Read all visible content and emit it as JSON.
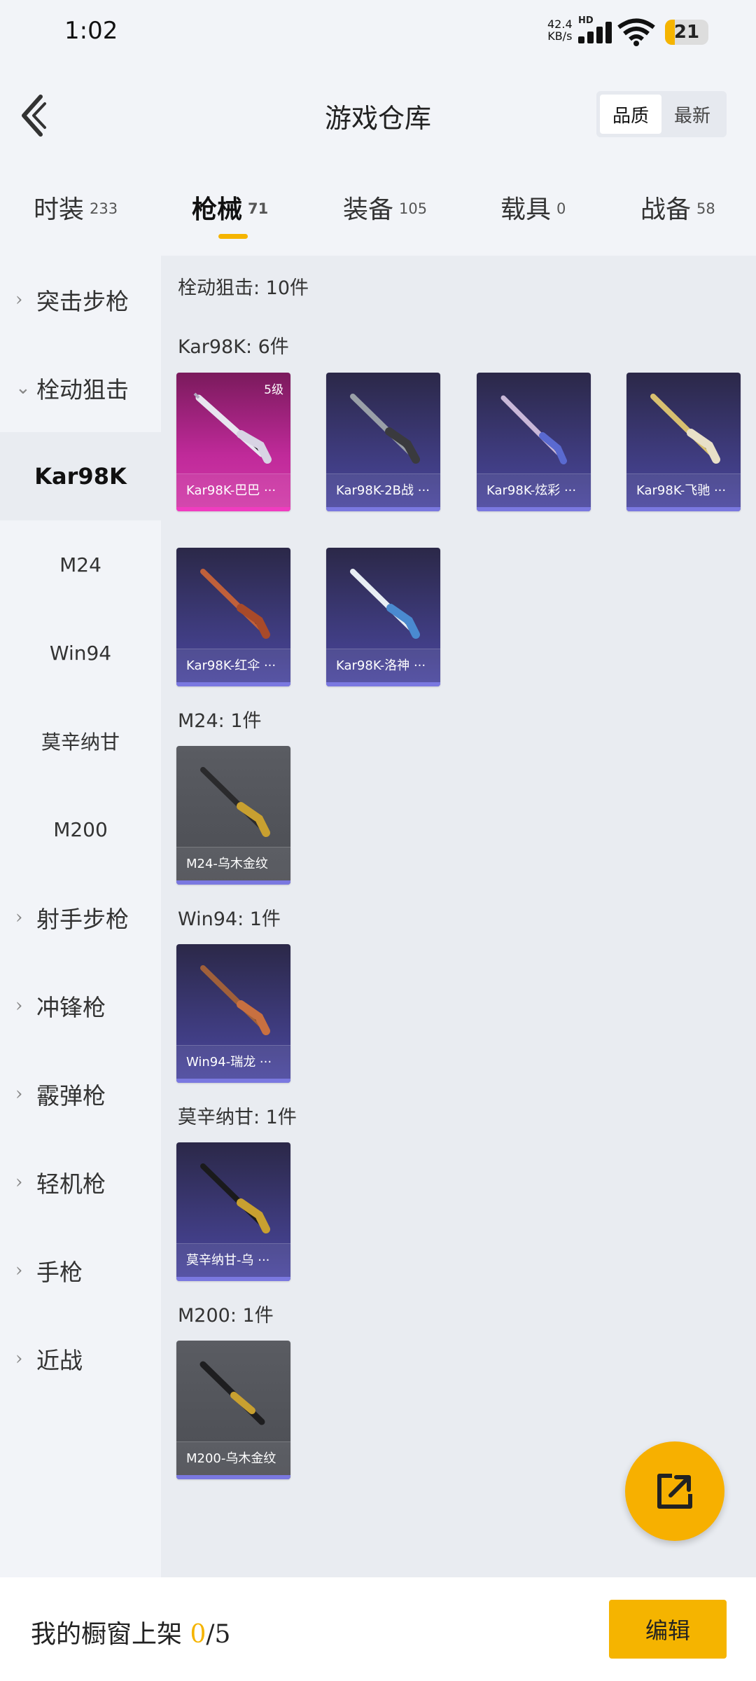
{
  "status_bar": {
    "time": "1:02",
    "net_speed_value": "42.4",
    "net_speed_unit": "KB/s",
    "net_type": "HD",
    "battery": "21"
  },
  "header": {
    "title": "游戏仓库",
    "sort_options": [
      "品质",
      "最新"
    ],
    "sort_selected": "品质"
  },
  "tabs": [
    {
      "label": "时装",
      "count": "233"
    },
    {
      "label": "枪械",
      "count": "71",
      "active": true
    },
    {
      "label": "装备",
      "count": "105"
    },
    {
      "label": "载具",
      "count": "0"
    },
    {
      "label": "战备",
      "count": "58"
    }
  ],
  "sidebar": [
    {
      "label": "突击步枪",
      "type": "parent",
      "expanded": false
    },
    {
      "label": "栓动狙击",
      "type": "parent",
      "expanded": true
    },
    {
      "label": "Kar98K",
      "type": "child",
      "selected": true
    },
    {
      "label": "M24",
      "type": "child"
    },
    {
      "label": "Win94",
      "type": "child"
    },
    {
      "label": "莫辛纳甘",
      "type": "child"
    },
    {
      "label": "M200",
      "type": "child"
    },
    {
      "label": "射手步枪",
      "type": "parent",
      "expanded": false
    },
    {
      "label": "冲锋枪",
      "type": "parent",
      "expanded": false
    },
    {
      "label": "霰弹枪",
      "type": "parent",
      "expanded": false
    },
    {
      "label": "轻机枪",
      "type": "parent",
      "expanded": false
    },
    {
      "label": "手枪",
      "type": "parent",
      "expanded": false
    },
    {
      "label": "近战",
      "type": "parent",
      "expanded": false
    }
  ],
  "main": {
    "category_summary": "栓动狙击: 10件",
    "sections": [
      {
        "heading": "Kar98K: 6件",
        "items": [
          {
            "label": "Kar98K-巴巴 ···",
            "level": "5级",
            "rarity": "pink"
          },
          {
            "label": "Kar98K-2B战 ···",
            "rarity": "purple"
          },
          {
            "label": "Kar98K-炫彩 ···",
            "rarity": "purple"
          },
          {
            "label": "Kar98K-飞驰 ···",
            "rarity": "purple"
          },
          {
            "label": "Kar98K-红伞 ···",
            "rarity": "purple"
          },
          {
            "label": "Kar98K-洛神 ···",
            "rarity": "purple"
          }
        ]
      },
      {
        "heading": "M24: 1件",
        "items": [
          {
            "label": "M24-乌木金纹",
            "rarity": "gray"
          }
        ]
      },
      {
        "heading": "Win94: 1件",
        "items": [
          {
            "label": "Win94-瑞龙 ···",
            "rarity": "purple"
          }
        ]
      },
      {
        "heading": "莫辛纳甘: 1件",
        "items": [
          {
            "label": "莫辛纳甘-乌 ···",
            "rarity": "purple"
          }
        ]
      },
      {
        "heading": "M200: 1件",
        "items": [
          {
            "label": "M200-乌木金纹",
            "rarity": "gray"
          }
        ]
      }
    ]
  },
  "footer": {
    "text": "我的橱窗上架",
    "current": "0",
    "total": "/5",
    "edit_label": "编辑"
  },
  "colors": {
    "accent": "#f5b400",
    "purple_card": "#3d3a7a",
    "pink_card": "#c02a9a",
    "gray_card": "#505258"
  }
}
